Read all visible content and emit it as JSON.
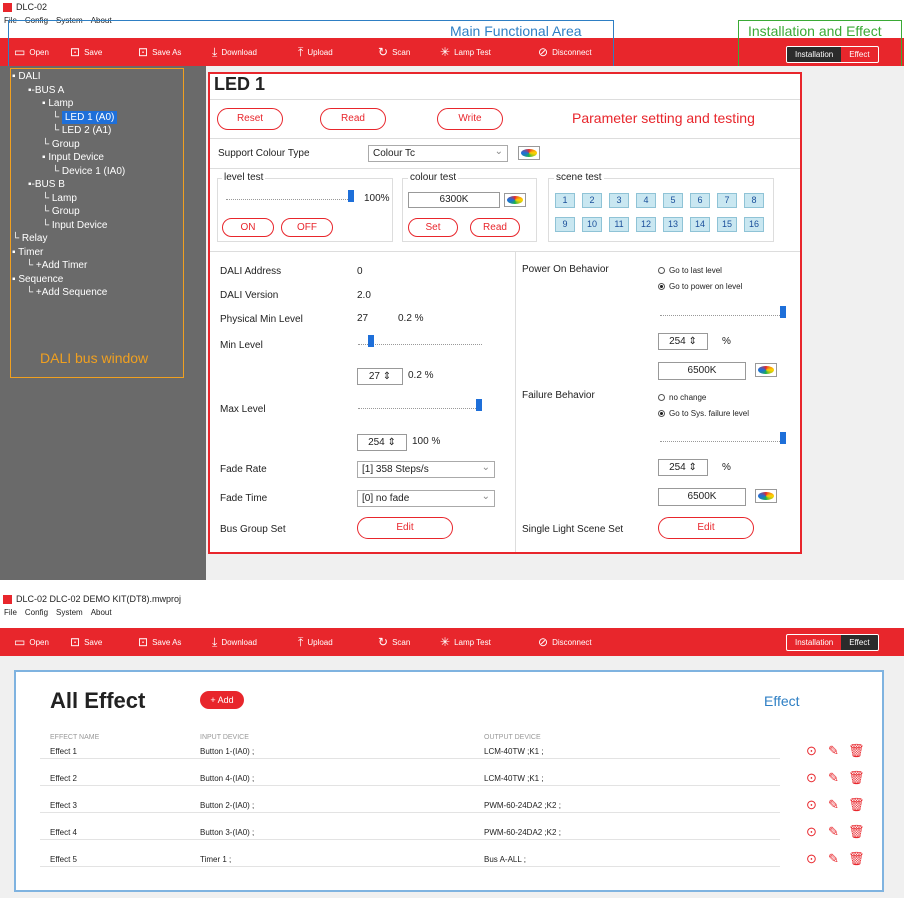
{
  "top": {
    "title": "DLC-02",
    "menu": [
      "File",
      "Config",
      "System",
      "About"
    ],
    "toolbar": [
      "Open",
      "Save",
      "Save As",
      "Download",
      "Upload",
      "Scan",
      "Lamp Test",
      "Disconnect"
    ],
    "seg": [
      "Installation",
      "Effect"
    ],
    "ann_main": "Main Functional Area",
    "ann_install": "Installation and Effect",
    "tree": [
      "DALI",
      "BUS A",
      "Lamp",
      "LED 1 (A0)",
      "LED 2 (A1)",
      "Group",
      "Input Device",
      "Device 1 (IA0)",
      "BUS B",
      "Lamp",
      "Group",
      "Input Device",
      "Relay",
      "Timer",
      "+Add Timer",
      "Sequence",
      "+Add Sequence"
    ],
    "ann_tree": "DALI bus window",
    "panel_title": "LED 1",
    "btn_reset": "Reset",
    "btn_read": "Read",
    "btn_write": "Write",
    "ann_param": "Parameter setting and testing",
    "support_label": "Support Colour Type",
    "support_value": "Colour Tc",
    "level_test": "level test",
    "level_pct": "100%",
    "btn_on": "ON",
    "btn_off": "OFF",
    "colour_test": "colour test",
    "colour_value": "6300K",
    "btn_set": "Set",
    "btn_cread": "Read",
    "scene_test": "scene test",
    "scenes": [
      "1",
      "2",
      "3",
      "4",
      "5",
      "6",
      "7",
      "8",
      "9",
      "10",
      "11",
      "12",
      "13",
      "14",
      "15",
      "16"
    ],
    "dali_address_l": "DALI Address",
    "dali_address_v": "0",
    "dali_version_l": "DALI Version",
    "dali_version_v": "2.0",
    "phys_l": "Physical Min Level",
    "phys_v": "27",
    "phys_p": "0.2 %",
    "min_l": "Min Level",
    "min_v": "27",
    "min_p": "0.2 %",
    "max_l": "Max Level",
    "max_v": "254",
    "max_p": "100 %",
    "fade_rate_l": "Fade Rate",
    "fade_rate_v": "[1] 358 Steps/s",
    "fade_time_l": "Fade Time",
    "fade_time_v": "[0] no fade",
    "bus_group_l": "Bus Group Set",
    "edit": "Edit",
    "pob_l": "Power On Behavior",
    "pob_o1": "Go to last level",
    "pob_o2": "Go to power on level",
    "pob_v": "254",
    "pct": "%",
    "pob_k": "6500K",
    "fb_l": "Failure Behavior",
    "fb_o1": "no change",
    "fb_o2": "Go to Sys. failure level",
    "fb_v": "254",
    "fb_k": "6500K",
    "slss_l": "Single Light Scene Set"
  },
  "bottom": {
    "title": "DLC-02   DLC-02 DEMO KIT(DT8).mwproj",
    "heading": "All Effect",
    "add": "+ Add",
    "ann_effect": "Effect",
    "cols": [
      "EFFECT NAME",
      "INPUT DEVICE",
      "OUTPUT DEVICE"
    ],
    "rows": [
      {
        "name": "Effect 1",
        "input": "Button 1-(IA0) ;",
        "output": "LCM-40TW ;K1 ;"
      },
      {
        "name": "Effect 2",
        "input": "Button 4-(IA0) ;",
        "output": "LCM-40TW ;K1 ;"
      },
      {
        "name": "Effect 3",
        "input": "Button 2-(IA0) ;",
        "output": "PWM-60-24DA2 ;K2 ;"
      },
      {
        "name": "Effect 4",
        "input": "Button 3-(IA0) ;",
        "output": "PWM-60-24DA2 ;K2 ;"
      },
      {
        "name": "Effect 5",
        "input": "Timer 1 ;",
        "output": "Bus A-ALL ;"
      }
    ]
  },
  "colors": {
    "accent": "#e8262c",
    "select": "#1e6fd9",
    "annot_blue": "#2e7fc4",
    "annot_green": "#3aaa35",
    "annot_orange": "#f0a020"
  }
}
